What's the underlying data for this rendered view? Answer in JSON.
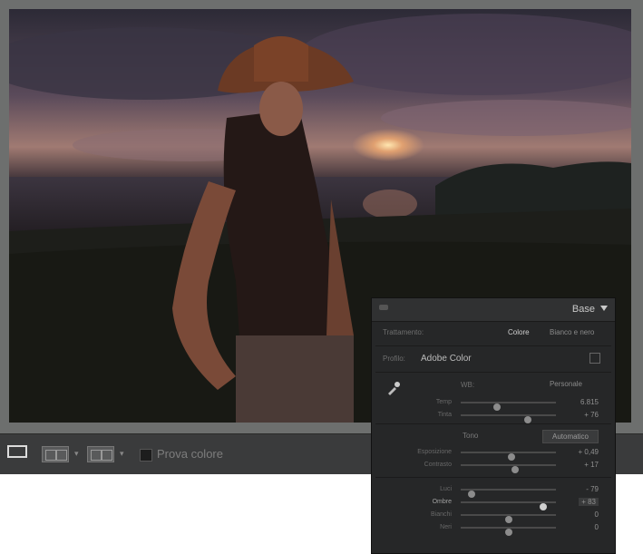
{
  "toolbar": {
    "proof_label": "Prova colore",
    "view_icons": [
      "single-view-icon",
      "compare-view-icon",
      "survey-view-icon"
    ]
  },
  "panel": {
    "title": "Base",
    "treatment_label": "Trattamento:",
    "treatment_color": "Colore",
    "treatment_bw": "Bianco e nero",
    "profile_label": "Profilo:",
    "profile_value": "Adobe Color",
    "wb_label": "WB:",
    "wb_value": "Personale",
    "sliders_wb": [
      {
        "label": "Temp",
        "value": "6.815",
        "pos": 0.38
      },
      {
        "label": "Tinta",
        "value": "+ 76",
        "pos": 0.7
      }
    ],
    "tone_label": "Tono",
    "auto_label": "Automatico",
    "sliders_tone": [
      {
        "label": "Esposizione",
        "value": "+ 0,49",
        "pos": 0.53
      },
      {
        "label": "Contrasto",
        "value": "+ 17",
        "pos": 0.57
      }
    ],
    "sliders_presence": [
      {
        "label": "Luci",
        "value": "- 79",
        "pos": 0.11
      },
      {
        "label": "Ombre",
        "value": "+ 83",
        "pos": 0.87
      },
      {
        "label": "Bianchi",
        "value": "0",
        "pos": 0.5
      },
      {
        "label": "Neri",
        "value": "0",
        "pos": 0.5
      }
    ],
    "colors": {
      "panel_bg": "#262728",
      "accent": "#c9c9c9"
    }
  }
}
